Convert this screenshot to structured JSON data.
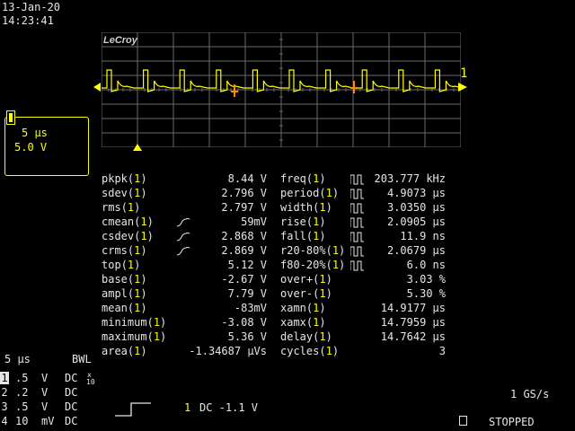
{
  "header": {
    "date": "13-Jan-20",
    "time": "14:23:41"
  },
  "display": {
    "logo": "LeCroy",
    "trace_marker": "1"
  },
  "channel_box": {
    "badge": "1",
    "timebase": "5 μs",
    "volts_div": "5.0 V"
  },
  "measurements": {
    "left": [
      {
        "param": "pkpk",
        "ch": "1",
        "icon": "",
        "value": "8.44 V"
      },
      {
        "param": "sdev",
        "ch": "1",
        "icon": "",
        "value": "2.796 V"
      },
      {
        "param": "rms",
        "ch": "1",
        "icon": "",
        "value": "2.797 V"
      },
      {
        "param": "cmean",
        "ch": "1",
        "icon": "cycle-icon",
        "value": "59mV"
      },
      {
        "param": "csdev",
        "ch": "1",
        "icon": "cycle-icon",
        "value": "2.868 V"
      },
      {
        "param": "crms",
        "ch": "1",
        "icon": "cycle-icon",
        "value": "2.869 V"
      },
      {
        "param": "top",
        "ch": "1",
        "icon": "",
        "value": "5.12 V"
      },
      {
        "param": "base",
        "ch": "1",
        "icon": "",
        "value": "-2.67 V"
      },
      {
        "param": "ampl",
        "ch": "1",
        "icon": "",
        "value": "7.79 V"
      },
      {
        "param": "mean",
        "ch": "1",
        "icon": "",
        "value": "-83mV"
      },
      {
        "param": "minimum",
        "ch": "1",
        "icon": "",
        "value": "-3.08 V"
      },
      {
        "param": "maximum",
        "ch": "1",
        "icon": "",
        "value": "5.36 V"
      },
      {
        "param": "area",
        "ch": "1",
        "icon": "",
        "value": "-1.34687 μVs"
      }
    ],
    "right": [
      {
        "param": "freq",
        "ch": "1",
        "icon": "pulse-icon",
        "value": "203.777 kHz"
      },
      {
        "param": "period",
        "ch": "1",
        "icon": "pulse-icon",
        "value": "4.9073 μs"
      },
      {
        "param": "width",
        "ch": "1",
        "icon": "pulse-icon",
        "value": "3.0350 μs"
      },
      {
        "param": "rise",
        "ch": "1",
        "icon": "pulse-icon",
        "value": "2.0905 μs"
      },
      {
        "param": "fall",
        "ch": "1",
        "icon": "pulse-icon",
        "value": "11.9 ns"
      },
      {
        "param": "r20-80%",
        "ch": "1",
        "icon": "pulse-icon",
        "value": "2.0679 μs"
      },
      {
        "param": "f80-20%",
        "ch": "1",
        "icon": "pulse-icon",
        "value": "6.0 ns"
      },
      {
        "param": "over+",
        "ch": "1",
        "icon": "",
        "value": "3.03 %"
      },
      {
        "param": "over-",
        "ch": "1",
        "icon": "",
        "value": "5.30 %"
      },
      {
        "param": "xamn",
        "ch": "1",
        "icon": "",
        "value": "14.9177 μs"
      },
      {
        "param": "xamx",
        "ch": "1",
        "icon": "",
        "value": "14.7959 μs"
      },
      {
        "param": "delay",
        "ch": "1",
        "icon": "",
        "value": "14.7642 μs"
      },
      {
        "param": "cycles",
        "ch": "1",
        "icon": "",
        "value": "3"
      }
    ]
  },
  "bottom": {
    "timebase": "5 μs",
    "bwl": "BWL",
    "channels": [
      {
        "num": "1",
        "vdiv": ".5",
        "unit": "V",
        "coupling": "DC",
        "frac_top": "x",
        "frac_bot": "10"
      },
      {
        "num": "2",
        "vdiv": ".2",
        "unit": "V",
        "coupling": "DC",
        "frac_top": "",
        "frac_bot": ""
      },
      {
        "num": "3",
        "vdiv": ".5",
        "unit": "V",
        "coupling": "DC",
        "frac_top": "",
        "frac_bot": ""
      },
      {
        "num": "4",
        "vdiv": "10",
        "unit": "mV",
        "coupling": "DC",
        "frac_top": "",
        "frac_bot": ""
      }
    ],
    "trigger": {
      "channel": "1",
      "config": "DC -1.1 V"
    },
    "sample_rate": "1 GS/s",
    "status": "STOPPED"
  }
}
